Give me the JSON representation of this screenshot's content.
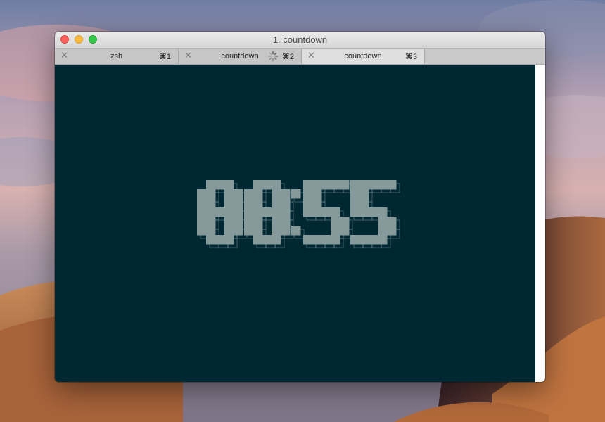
{
  "desktop": {
    "wallpaper": "mojave-dunes-dusk"
  },
  "window": {
    "title": "1. countdown",
    "traffic_lights": {
      "close": "#fc605c",
      "minimize": "#fdbc40",
      "maximize": "#34c84a"
    },
    "tabs": [
      {
        "label": "zsh",
        "shortcut": "⌘1",
        "active": false,
        "busy": false
      },
      {
        "label": "countdown",
        "shortcut": "⌘2",
        "active": false,
        "busy": true
      },
      {
        "label": "countdown",
        "shortcut": "⌘3",
        "active": true,
        "busy": false
      }
    ]
  },
  "terminal": {
    "background": "#002833",
    "foreground": "#86999b",
    "countdown": "00:55"
  },
  "icons": {
    "tab_close": "close-icon",
    "busy": "spinner-icon"
  }
}
